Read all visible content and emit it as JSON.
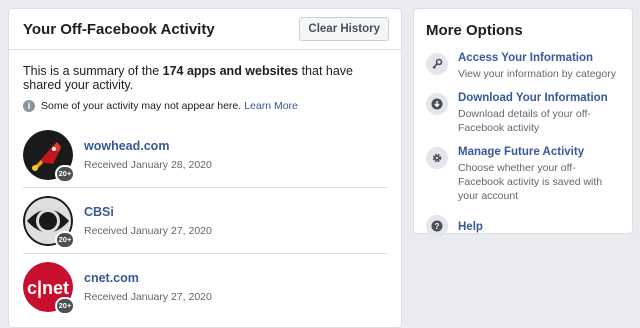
{
  "activity": {
    "title": "Your Off-Facebook Activity",
    "clear_button": "Clear History",
    "summary_prefix": "This is a summary of the ",
    "summary_bold": "174 apps and websites",
    "summary_suffix": " that have shared your activity.",
    "notice": "Some of your activity may not appear here.",
    "notice_link": "Learn More",
    "items": [
      {
        "name": "wowhead.com",
        "date": "Received January 28, 2020",
        "badge": "20+"
      },
      {
        "name": "CBSi",
        "date": "Received January 27, 2020",
        "badge": "20+"
      },
      {
        "name": "cnet.com",
        "date": "Received January 27, 2020",
        "badge": "20+"
      }
    ]
  },
  "options": {
    "title": "More Options",
    "items": [
      {
        "title": "Access Your Information",
        "desc": "View your information by category",
        "icon": "key-icon"
      },
      {
        "title": "Download Your Information",
        "desc": "Download details of your off-Facebook activity",
        "icon": "download-icon"
      },
      {
        "title": "Manage Future Activity",
        "desc": "Choose whether your off-Facebook activity is saved with your account",
        "icon": "gear-icon"
      },
      {
        "title": "Help",
        "desc": "",
        "icon": "help-icon"
      }
    ]
  },
  "colors": {
    "link": "#385898",
    "background": "#e9ebee"
  }
}
